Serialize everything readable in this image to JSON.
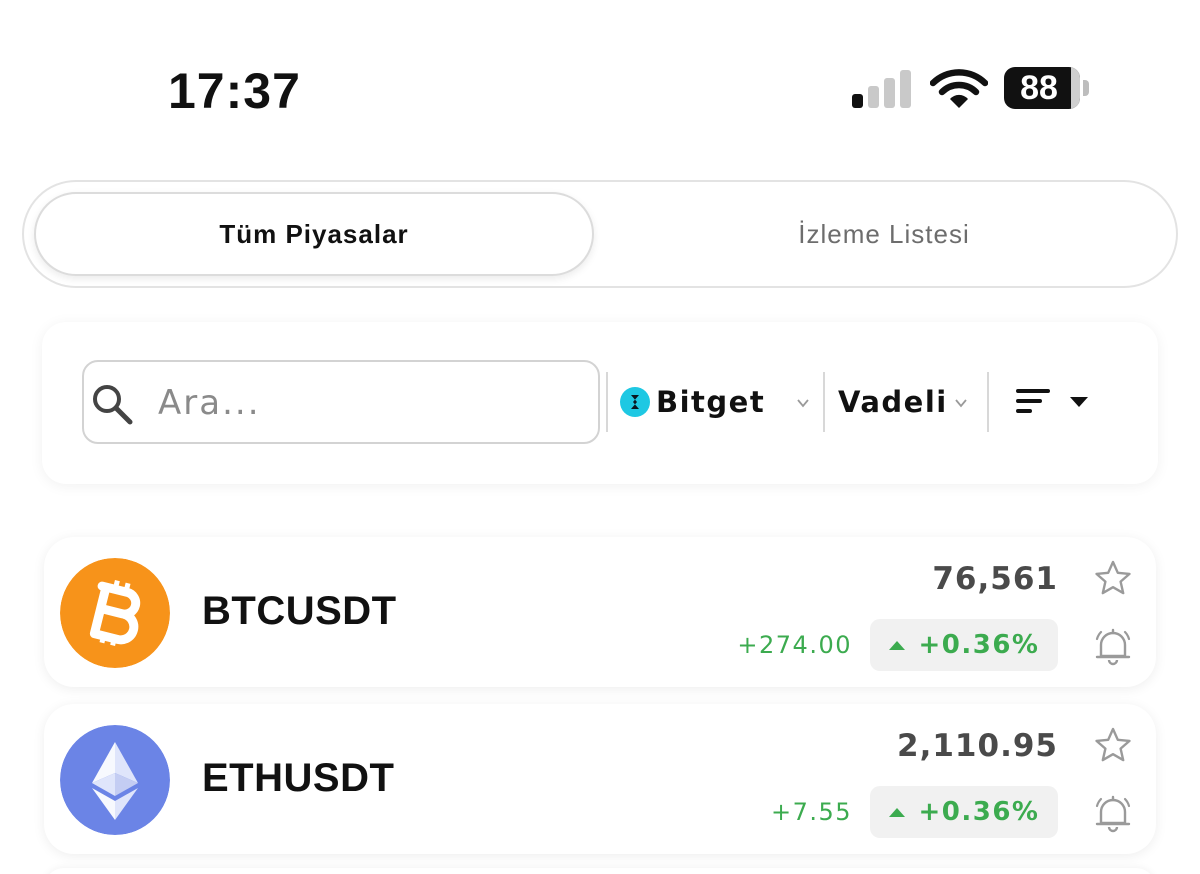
{
  "status_bar": {
    "time": "17:37",
    "battery_level": "88",
    "signal_bars": 1,
    "icons": [
      "cellular-signal-icon",
      "wifi-icon",
      "battery-icon"
    ]
  },
  "tabs": [
    {
      "label": "Tüm Piyasalar",
      "active": true
    },
    {
      "label": "İzleme Listesi",
      "active": false
    }
  ],
  "filters": {
    "search_placeholder": "Ara...",
    "exchange": {
      "name": "Bitget",
      "logo_color": "#1ec8e3"
    },
    "market_type": "Vadeli",
    "sort_icon": "sort-lines-icon"
  },
  "markets": [
    {
      "symbol": "BTCUSDT",
      "price": "76,561",
      "change": "+274.00",
      "change_percent": "+0.36%",
      "icon": "bitcoin-icon",
      "icon_color": "#f7931a"
    },
    {
      "symbol": "ETHUSDT",
      "price": "2,110.95",
      "change": "+7.55",
      "change_percent": "+0.36%",
      "icon": "ethereum-icon",
      "icon_color": "#6b84e6"
    }
  ],
  "colors": {
    "positive": "#3cab4f",
    "badge_background": "#f1f1f1",
    "muted_text": "#6d6d6d"
  }
}
